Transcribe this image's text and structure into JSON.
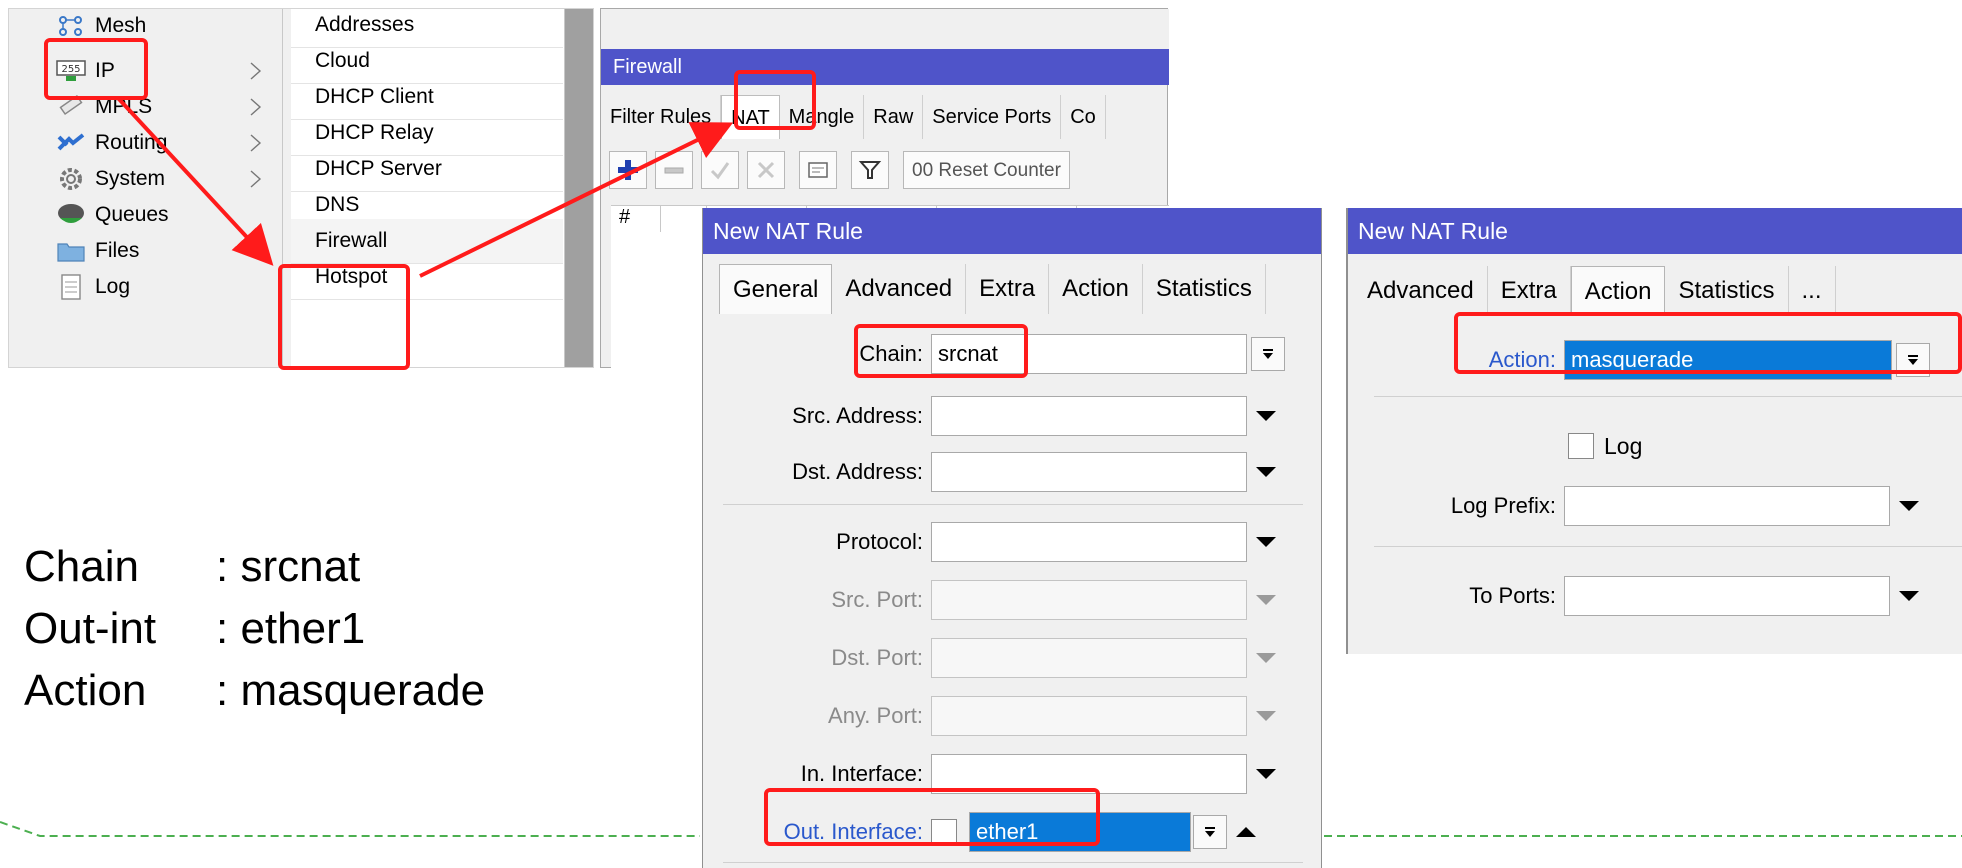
{
  "menu": {
    "items": [
      {
        "label": "Mesh",
        "icon": "mesh-icon",
        "has_submenu": false
      },
      {
        "label": "IP",
        "icon": "ip-icon",
        "has_submenu": true
      },
      {
        "label": "MPLS",
        "icon": "mpls-icon",
        "has_submenu": true
      },
      {
        "label": "Routing",
        "icon": "routing-icon",
        "has_submenu": true
      },
      {
        "label": "System",
        "icon": "system-gear-icon",
        "has_submenu": true
      },
      {
        "label": "Queues",
        "icon": "queues-icon",
        "has_submenu": false
      },
      {
        "label": "Files",
        "icon": "files-folder-icon",
        "has_submenu": false
      },
      {
        "label": "Log",
        "icon": "log-document-icon",
        "has_submenu": false
      }
    ],
    "ip_icon_text": "255",
    "submenu": [
      "Addresses",
      "Cloud",
      "DHCP Client",
      "DHCP Relay",
      "DHCP Server",
      "DNS",
      "Firewall",
      "Hotspot"
    ]
  },
  "firewall": {
    "title": "Firewall",
    "tabs": [
      "Filter Rules",
      "NAT",
      "Mangle",
      "Raw",
      "Service Ports",
      "Co"
    ],
    "active_tab": "NAT",
    "reset_counters_label": "Reset Counter",
    "reset_counters_prefix": "00",
    "table_header": [
      "#"
    ]
  },
  "nat_general": {
    "title": "New NAT Rule",
    "tabs": [
      "General",
      "Advanced",
      "Extra",
      "Action",
      "Statistics"
    ],
    "active_tab": "General",
    "fields": {
      "chain": {
        "label": "Chain:",
        "value": "srcnat"
      },
      "src_address": {
        "label": "Src. Address:",
        "value": ""
      },
      "dst_address": {
        "label": "Dst. Address:",
        "value": ""
      },
      "protocol": {
        "label": "Protocol:",
        "value": ""
      },
      "src_port": {
        "label": "Src. Port:",
        "value": ""
      },
      "dst_port": {
        "label": "Dst. Port:",
        "value": ""
      },
      "any_port": {
        "label": "Any. Port:",
        "value": ""
      },
      "in_interface": {
        "label": "In. Interface:",
        "value": ""
      },
      "out_interface": {
        "label": "Out. Interface:",
        "value": "ether1"
      }
    }
  },
  "nat_action": {
    "title": "New NAT Rule",
    "tabs": [
      "Advanced",
      "Extra",
      "Action",
      "Statistics",
      "..."
    ],
    "active_tab": "Action",
    "action": {
      "label": "Action:",
      "value": "masquerade"
    },
    "log": {
      "label": "Log",
      "checked": false
    },
    "log_prefix": {
      "label": "Log Prefix:",
      "value": ""
    },
    "to_ports": {
      "label": "To Ports:",
      "value": ""
    }
  },
  "notes": [
    {
      "key": "Chain",
      "value": ": srcnat"
    },
    {
      "key": "Out-int",
      "value": ": ether1"
    },
    {
      "key": "Action",
      "value": ": masquerade"
    }
  ],
  "colors": {
    "title_bar": "#4f54c9",
    "highlight": "#ff1b1b",
    "selection": "#0a7ad8",
    "blue_label": "#2a58cc",
    "dashed_line": "#4caf50"
  }
}
